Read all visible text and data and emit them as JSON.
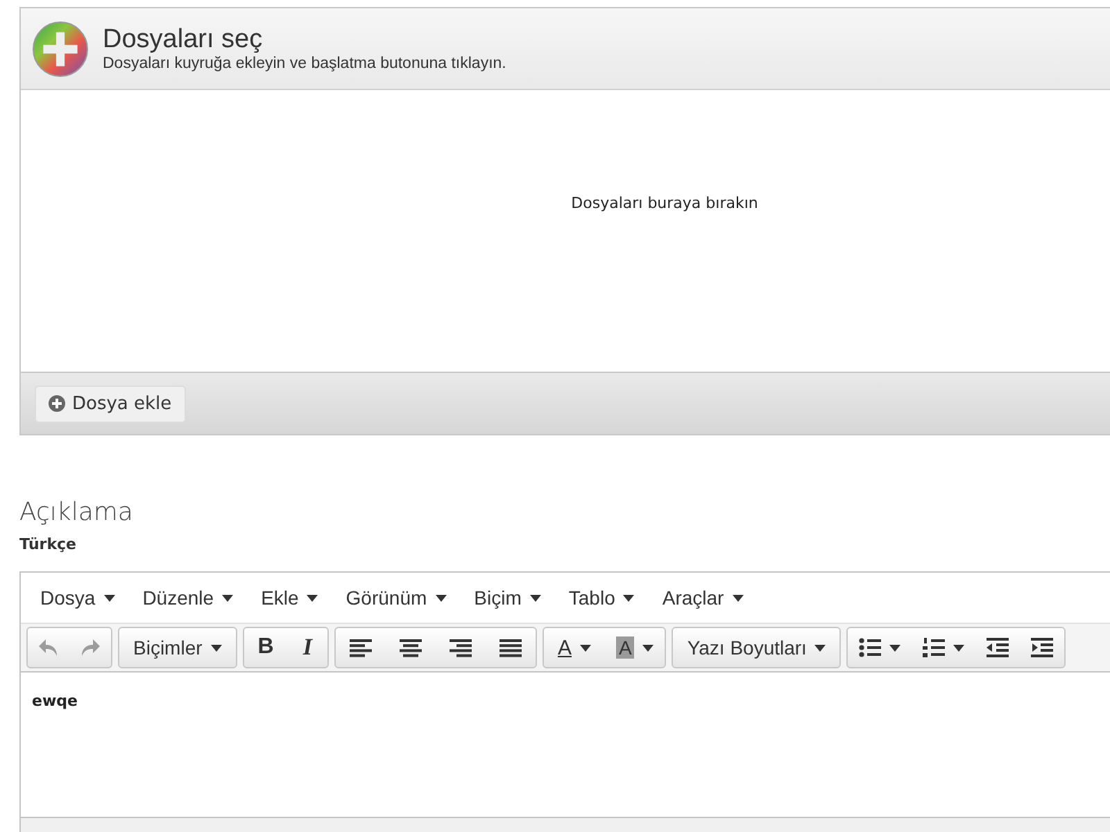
{
  "uploader": {
    "title": "Dosyaları seç",
    "subtitle": "Dosyaları kuyruğa ekleyin ve başlatma butonuna tıklayın.",
    "drop_hint": "Dosyaları buraya bırakın",
    "add_button": "Dosya ekle"
  },
  "description": {
    "heading": "Açıklama",
    "language": "Türkçe"
  },
  "editor": {
    "menus": [
      "Dosya",
      "Düzenle",
      "Ekle",
      "Görünüm",
      "Biçim",
      "Tablo",
      "Araçlar"
    ],
    "toolbar": [
      [
        {
          "kind": "undo",
          "disabled": true
        },
        {
          "kind": "redo",
          "disabled": true
        }
      ],
      [
        {
          "kind": "dropdown",
          "label": "Biçimler",
          "disabled": false
        }
      ],
      [
        {
          "kind": "bold",
          "label": "B",
          "disabled": false
        },
        {
          "kind": "italic",
          "label": "I",
          "disabled": false
        }
      ],
      [
        {
          "kind": "align-left",
          "disabled": false
        },
        {
          "kind": "align-center",
          "disabled": false
        },
        {
          "kind": "align-right",
          "disabled": false
        },
        {
          "kind": "justify",
          "disabled": false
        }
      ],
      [
        {
          "kind": "text-color",
          "label": "A",
          "disabled": false
        },
        {
          "kind": "background-color",
          "label": "A",
          "disabled": false
        }
      ],
      [
        {
          "kind": "dropdown",
          "label": "Yazı Boyutları",
          "disabled": false
        }
      ],
      [
        {
          "kind": "bullet-list",
          "disabled": false
        },
        {
          "kind": "numbered-list",
          "disabled": false
        },
        {
          "kind": "outdent",
          "disabled": false
        },
        {
          "kind": "indent",
          "disabled": false
        }
      ]
    ],
    "content": "ewqe"
  }
}
